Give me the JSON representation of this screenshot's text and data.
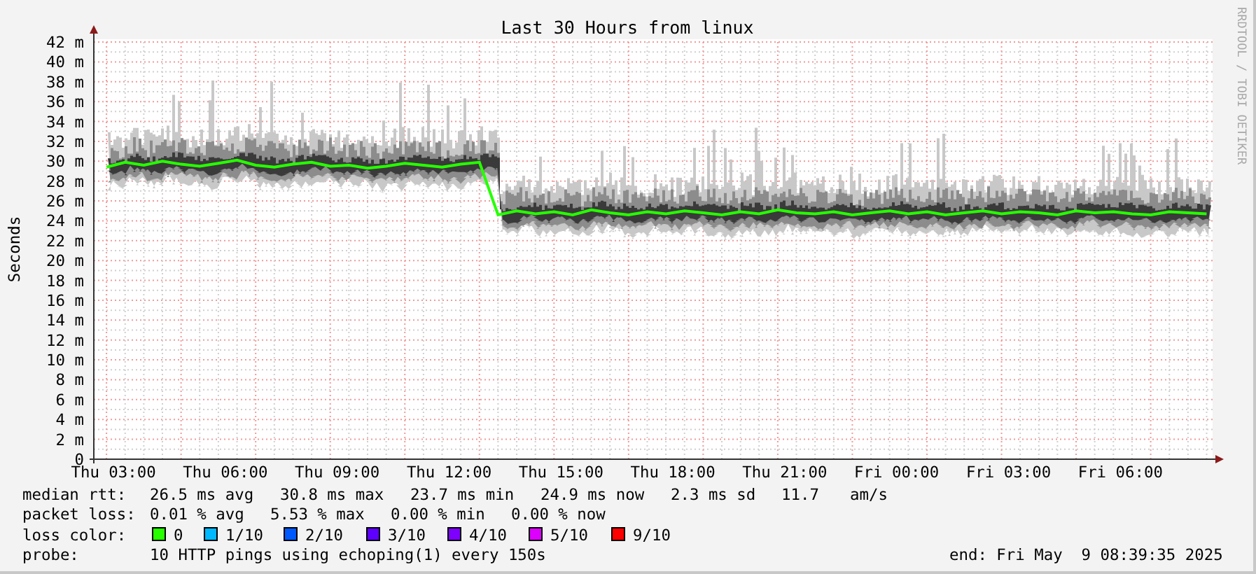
{
  "credit": "RRDTOOL / TOBI OETIKER",
  "chart_data": {
    "type": "line",
    "title": "Last 30 Hours from linux",
    "ylabel": "Seconds",
    "ylim": [
      0,
      42
    ],
    "grid": true,
    "yticks": [
      {
        "value": 0,
        "label": "0"
      },
      {
        "value": 2,
        "label": "2 m"
      },
      {
        "value": 4,
        "label": "4 m"
      },
      {
        "value": 6,
        "label": "6 m"
      },
      {
        "value": 8,
        "label": "8 m"
      },
      {
        "value": 10,
        "label": "10 m"
      },
      {
        "value": 12,
        "label": "12 m"
      },
      {
        "value": 14,
        "label": "14 m"
      },
      {
        "value": 16,
        "label": "16 m"
      },
      {
        "value": 18,
        "label": "18 m"
      },
      {
        "value": 20,
        "label": "20 m"
      },
      {
        "value": 22,
        "label": "22 m"
      },
      {
        "value": 24,
        "label": "24 m"
      },
      {
        "value": 26,
        "label": "26 m"
      },
      {
        "value": 28,
        "label": "28 m"
      },
      {
        "value": 30,
        "label": "30 m"
      },
      {
        "value": 32,
        "label": "32 m"
      },
      {
        "value": 34,
        "label": "34 m"
      },
      {
        "value": 36,
        "label": "36 m"
      },
      {
        "value": 38,
        "label": "38 m"
      },
      {
        "value": 40,
        "label": "40 m"
      },
      {
        "value": 42,
        "label": "42 m"
      }
    ],
    "categories": [
      "Thu 03:00",
      null,
      null,
      null,
      null,
      null,
      "Thu 06:00",
      null,
      null,
      null,
      null,
      null,
      "Thu 09:00",
      null,
      null,
      null,
      null,
      null,
      "Thu 12:00",
      null,
      null,
      null,
      null,
      null,
      "Thu 15:00",
      null,
      null,
      null,
      null,
      null,
      "Thu 18:00",
      null,
      null,
      null,
      null,
      null,
      "Thu 21:00",
      null,
      null,
      null,
      null,
      null,
      "Fri 00:00",
      null,
      null,
      null,
      null,
      null,
      "Fri 03:00",
      null,
      null,
      null,
      null,
      null,
      "Fri 06:00",
      null,
      null,
      null,
      null,
      null
    ],
    "series": [
      {
        "color": "#26ff00",
        "values": [
          29.4,
          29.9,
          29.6,
          30.0,
          29.7,
          29.5,
          29.8,
          30.1,
          29.6,
          29.4,
          29.7,
          29.9,
          29.5,
          29.6,
          29.3,
          29.5,
          29.8,
          29.6,
          29.4,
          29.7,
          29.9,
          24.6,
          25.0,
          24.7,
          24.9,
          24.6,
          25.1,
          24.8,
          24.6,
          24.9,
          24.7,
          25.0,
          24.8,
          24.6,
          24.9,
          24.7,
          25.1,
          24.8,
          24.7,
          24.9,
          24.6,
          24.8,
          25.0,
          24.7,
          24.9,
          24.6,
          24.8,
          25.0,
          24.7,
          24.9,
          24.8,
          24.6,
          25.0,
          24.8,
          24.9,
          24.7,
          24.6,
          24.9,
          24.8,
          24.7
        ]
      }
    ]
  },
  "legend": {
    "median_rtt": {
      "label": "median rtt:",
      "values": [
        "26.5 ms avg",
        "30.8 ms max",
        "23.7 ms min",
        "24.9 ms now",
        "2.3 ms sd",
        "11.7",
        "am/s"
      ]
    },
    "packet_loss": {
      "label": "packet loss:",
      "values": [
        "0.01 % avg",
        "5.53 % max",
        "0.00 % min",
        "0.00 % now"
      ]
    },
    "loss_color": {
      "label": "loss color:",
      "items": [
        {
          "label": "0",
          "color": "#26ff00"
        },
        {
          "label": "1/10",
          "color": "#00b8ff"
        },
        {
          "label": "2/10",
          "color": "#0059ff"
        },
        {
          "label": "3/10",
          "color": "#5e00ff"
        },
        {
          "label": "4/10",
          "color": "#7e00ff"
        },
        {
          "label": "5/10",
          "color": "#dd00ff"
        },
        {
          "label": "9/10",
          "color": "#ff0000"
        }
      ]
    },
    "probe": {
      "label": "probe:",
      "text": "10 HTTP pings using echoping(1) every 150s"
    },
    "end": "end: Fri May  9 08:39:35 2025"
  }
}
